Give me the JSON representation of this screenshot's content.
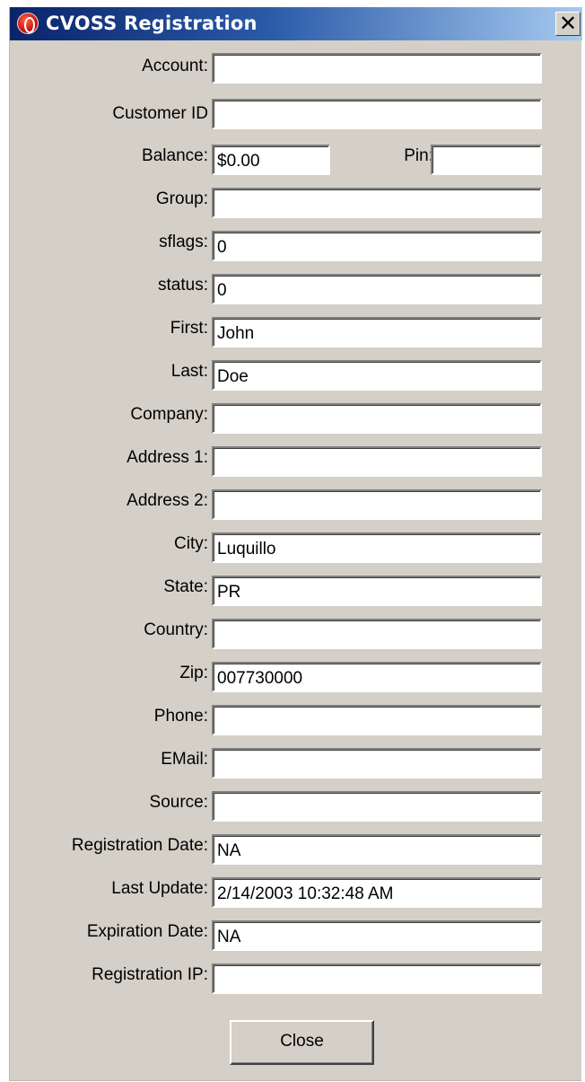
{
  "window": {
    "title": "CVOSS Registration",
    "close_glyph": "✕"
  },
  "icons": {
    "app": "red-oval-app-icon",
    "close": "close-icon"
  },
  "fields": {
    "account": {
      "label": "Account:",
      "value": ""
    },
    "customer_id": {
      "label": "Customer ID",
      "value": ""
    },
    "balance": {
      "label": "Balance:",
      "value": "$0.00"
    },
    "pin": {
      "label": "Pin:",
      "value": ""
    },
    "group": {
      "label": "Group:",
      "value": ""
    },
    "sflags": {
      "label": "sflags:",
      "value": "0"
    },
    "status": {
      "label": "status:",
      "value": "0"
    },
    "first": {
      "label": "First:",
      "value": "John"
    },
    "last": {
      "label": "Last:",
      "value": "Doe"
    },
    "company": {
      "label": "Company:",
      "value": ""
    },
    "address1": {
      "label": "Address 1:",
      "value": ""
    },
    "address2": {
      "label": "Address 2:",
      "value": ""
    },
    "city": {
      "label": "City:",
      "value": "Luquillo"
    },
    "state": {
      "label": "State:",
      "value": "PR"
    },
    "country": {
      "label": "Country:",
      "value": ""
    },
    "zip": {
      "label": "Zip:",
      "value": "007730000"
    },
    "phone": {
      "label": "Phone:",
      "value": ""
    },
    "email": {
      "label": "EMail:",
      "value": ""
    },
    "source": {
      "label": "Source:",
      "value": ""
    },
    "registration_date": {
      "label": "Registration Date:",
      "value": "NA"
    },
    "last_update": {
      "label": "Last Update:",
      "value": "2/14/2003 10:32:48 AM"
    },
    "expiration_date": {
      "label": "Expiration Date:",
      "value": "NA"
    },
    "registration_ip": {
      "label": "Registration IP:",
      "value": ""
    }
  },
  "buttons": {
    "close": "Close"
  },
  "colors": {
    "dialog_bg": "#d4d0c8",
    "titlebar_start": "#0a246a",
    "titlebar_end": "#a6caf0"
  }
}
